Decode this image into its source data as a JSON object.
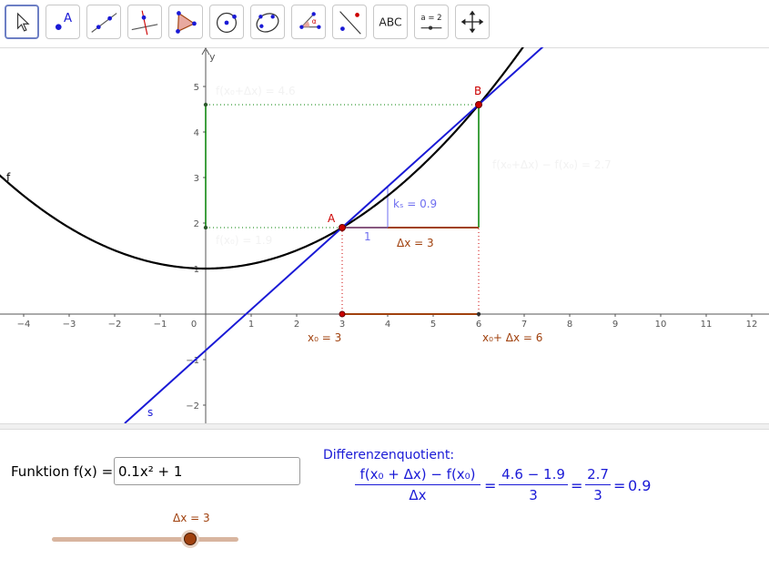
{
  "toolbar": {
    "tools": [
      {
        "name": "move-tool",
        "selected": true
      },
      {
        "name": "point-tool",
        "label": "A"
      },
      {
        "name": "line-tool"
      },
      {
        "name": "perpendicular-line-tool"
      },
      {
        "name": "polygon-tool"
      },
      {
        "name": "circle-tool"
      },
      {
        "name": "conic-tool"
      },
      {
        "name": "angle-tool",
        "label": "α"
      },
      {
        "name": "reflect-tool"
      },
      {
        "name": "text-tool",
        "label": "ABC"
      },
      {
        "name": "slider-tool",
        "label": "a = 2"
      },
      {
        "name": "move-graphics-view-tool"
      }
    ]
  },
  "graph": {
    "x_ticks": [
      "−4",
      "−3",
      "−2",
      "−1",
      "0",
      "1",
      "2",
      "3",
      "4",
      "5",
      "6",
      "7",
      "8",
      "9",
      "10",
      "11",
      "12"
    ],
    "y_ticks": [
      "5",
      "4",
      "3",
      "2",
      "1",
      "−1",
      "−2"
    ],
    "y_axis_label": "y",
    "func_label": "f",
    "secant_label": "s",
    "point_a": "A",
    "point_b": "B",
    "f_x0_label": "f(x₀) = 1.9",
    "f_x0_dx_label": "f(x₀+Δx) = 4.6",
    "delta_f_label": "f(x₀+Δx) − f(x₀) = 2.7",
    "slope_label": "kₛ = 0.9",
    "slope_run_label": "1",
    "dx_label": "Δx = 3",
    "x0_label": "x₀ = 3",
    "x0_dx_label": "x₀+ Δx = 6",
    "colors": {
      "function": "#000000",
      "secant": "#1a1ad6",
      "brown": "#a0410e",
      "green": "#008000",
      "red": "#cc0000"
    }
  },
  "algebra": {
    "func_label": "Funktion f(x) =",
    "func_value": "0.1x² + 1",
    "slider_label": "Δx = 3",
    "slider_value": 3,
    "dq_title": "Differenzenquotient:",
    "formula": {
      "num1": "f(x₀ + Δx) − f(x₀)",
      "den1": "Δx",
      "num2": "4.6 − 1.9",
      "den2": "3",
      "num3": "2.7",
      "den3": "3",
      "result": "0.9",
      "eq": "="
    }
  }
}
